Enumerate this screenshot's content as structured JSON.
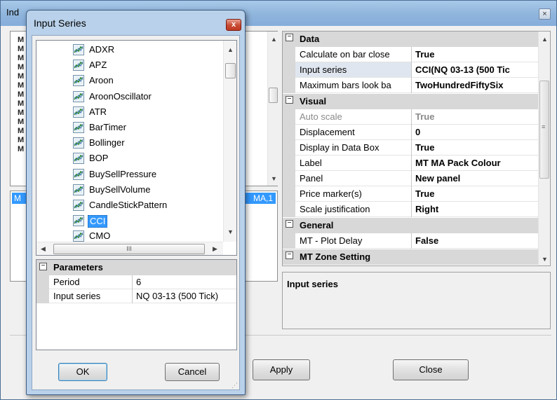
{
  "main_window": {
    "title": "Ind",
    "close_glyph": "×",
    "list_prefix": "M",
    "selected_suffix": "MA,1"
  },
  "properties": {
    "categories": [
      {
        "label": "Data",
        "rows": [
          {
            "name": "Calculate on bar close",
            "value": "True"
          },
          {
            "name": "Input series",
            "value": "CCI(NQ 03-13 (500 Tic"
          },
          {
            "name": "Maximum bars look ba",
            "value": "TwoHundredFiftySix"
          }
        ]
      },
      {
        "label": "Visual",
        "rows": [
          {
            "name": "Auto scale",
            "value": "True"
          },
          {
            "name": "Displacement",
            "value": "0"
          },
          {
            "name": "Display in Data Box",
            "value": "True"
          },
          {
            "name": "Label",
            "value": "MT MA Pack Colour"
          },
          {
            "name": "Panel",
            "value": "New panel"
          },
          {
            "name": "Price marker(s)",
            "value": "True"
          },
          {
            "name": "Scale justification",
            "value": "Right"
          }
        ]
      },
      {
        "label": "General",
        "rows": [
          {
            "name": "MT - Plot Delay",
            "value": "False"
          }
        ]
      },
      {
        "label": "MT Zone Setting",
        "rows": []
      }
    ],
    "description_title": "Input series"
  },
  "buttons": {
    "apply": "Apply",
    "close": "Close",
    "ok": "OK",
    "cancel": "Cancel"
  },
  "dialog": {
    "title": "Input Series",
    "close_glyph": "x",
    "series_items": [
      "ADXR",
      "APZ",
      "Aroon",
      "AroonOscillator",
      "ATR",
      "BarTimer",
      "Bollinger",
      "BOP",
      "BuySellPressure",
      "BuySellVolume",
      "CandleStickPattern",
      "CCI",
      "CMO"
    ],
    "selected_item": "CCI",
    "hscroll_grip": "III",
    "parameters": {
      "category": "Parameters",
      "rows": [
        {
          "name": "Period",
          "value": "6"
        },
        {
          "name": "Input series",
          "value": "NQ 03-13 (500 Tick)"
        }
      ]
    }
  },
  "colors": {
    "selection": "#3399ff",
    "category_bg": "#d8d8d8",
    "title_gradient": "#8fb5dc"
  }
}
